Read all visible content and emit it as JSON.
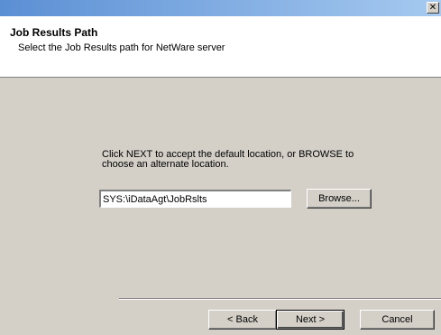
{
  "window": {
    "close_glyph": "✕"
  },
  "header": {
    "title": "Job Results Path",
    "subtitle": "Select the Job Results path for NetWare server"
  },
  "main": {
    "instruction": "Click NEXT to accept the default location, or BROWSE to\nchoose an alternate location.",
    "path_value": "SYS:\\iDataAgt\\JobRslts",
    "browse_label": "Browse..."
  },
  "footer": {
    "back_label": "< Back",
    "next_label": "Next >",
    "cancel_label": "Cancel"
  }
}
